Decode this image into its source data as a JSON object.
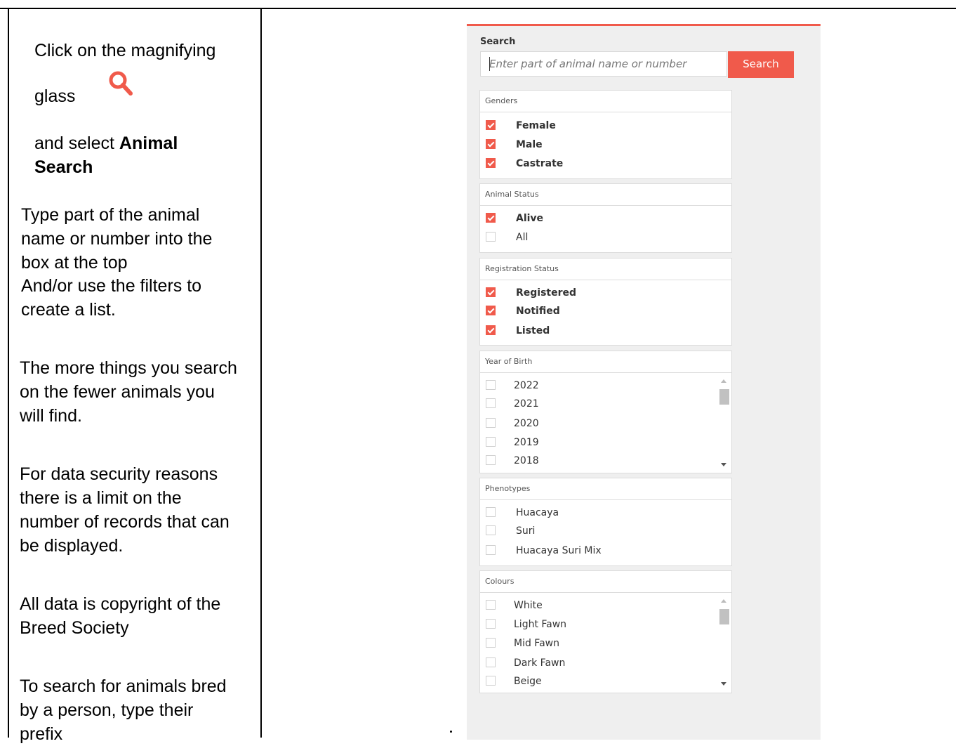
{
  "instructions": {
    "step1_line1": "Click on the magnifying",
    "step1_line2": "glass",
    "step1_line3": "and select",
    "step1_bold1": "Animal",
    "step1_bold2": "Search",
    "p2_l1": "Type part of the animal",
    "p2_l2": "name or number into the",
    "p2_l3": "box at the top",
    "p2_l4": "And/or use the filters to",
    "p2_l5": "create a list.",
    "p3_l1": "The more things you search",
    "p3_l2": "on the fewer animals you",
    "p3_l3": "will find.",
    "p4_l1": "For data security reasons",
    "p4_l2": "there is a limit on the",
    "p4_l3": "number of records that can",
    "p4_l4": "be displayed.",
    "p5_l1": "All data is copyright of the",
    "p5_l2": "Breed Society",
    "p6_l1": "To search for animals bred",
    "p6_l2": "by a person, type their",
    "p6_l3": "prefix",
    "icon": "magnifying-glass-icon",
    "icon_color": "#f05a4b"
  },
  "search": {
    "label": "Search",
    "placeholder": "Enter part of animal name or number",
    "button": "Search"
  },
  "filters": {
    "genders": {
      "title": "Genders",
      "items": [
        {
          "label": "Female",
          "checked": true
        },
        {
          "label": "Male",
          "checked": true
        },
        {
          "label": "Castrate",
          "checked": true
        }
      ]
    },
    "animal_status": {
      "title": "Animal Status",
      "items": [
        {
          "label": "Alive",
          "checked": true
        },
        {
          "label": "All",
          "checked": false
        }
      ]
    },
    "registration_status": {
      "title": "Registration Status",
      "items": [
        {
          "label": "Registered",
          "checked": true
        },
        {
          "label": "Notified",
          "checked": true
        },
        {
          "label": "Listed",
          "checked": true
        }
      ]
    },
    "year_of_birth": {
      "title": "Year of Birth",
      "items": [
        {
          "label": "2022",
          "checked": false
        },
        {
          "label": "2021",
          "checked": false
        },
        {
          "label": "2020",
          "checked": false
        },
        {
          "label": "2019",
          "checked": false
        },
        {
          "label": "2018",
          "checked": false
        }
      ]
    },
    "phenotypes": {
      "title": "Phenotypes",
      "items": [
        {
          "label": "Huacaya",
          "checked": false
        },
        {
          "label": "Suri",
          "checked": false
        },
        {
          "label": "Huacaya Suri Mix",
          "checked": false
        }
      ]
    },
    "colours": {
      "title": "Colours",
      "items": [
        {
          "label": "White",
          "checked": false
        },
        {
          "label": "Light Fawn",
          "checked": false
        },
        {
          "label": "Mid Fawn",
          "checked": false
        },
        {
          "label": "Dark Fawn",
          "checked": false
        },
        {
          "label": "Beige",
          "checked": false
        }
      ]
    }
  },
  "accent_color": "#f05a4b"
}
